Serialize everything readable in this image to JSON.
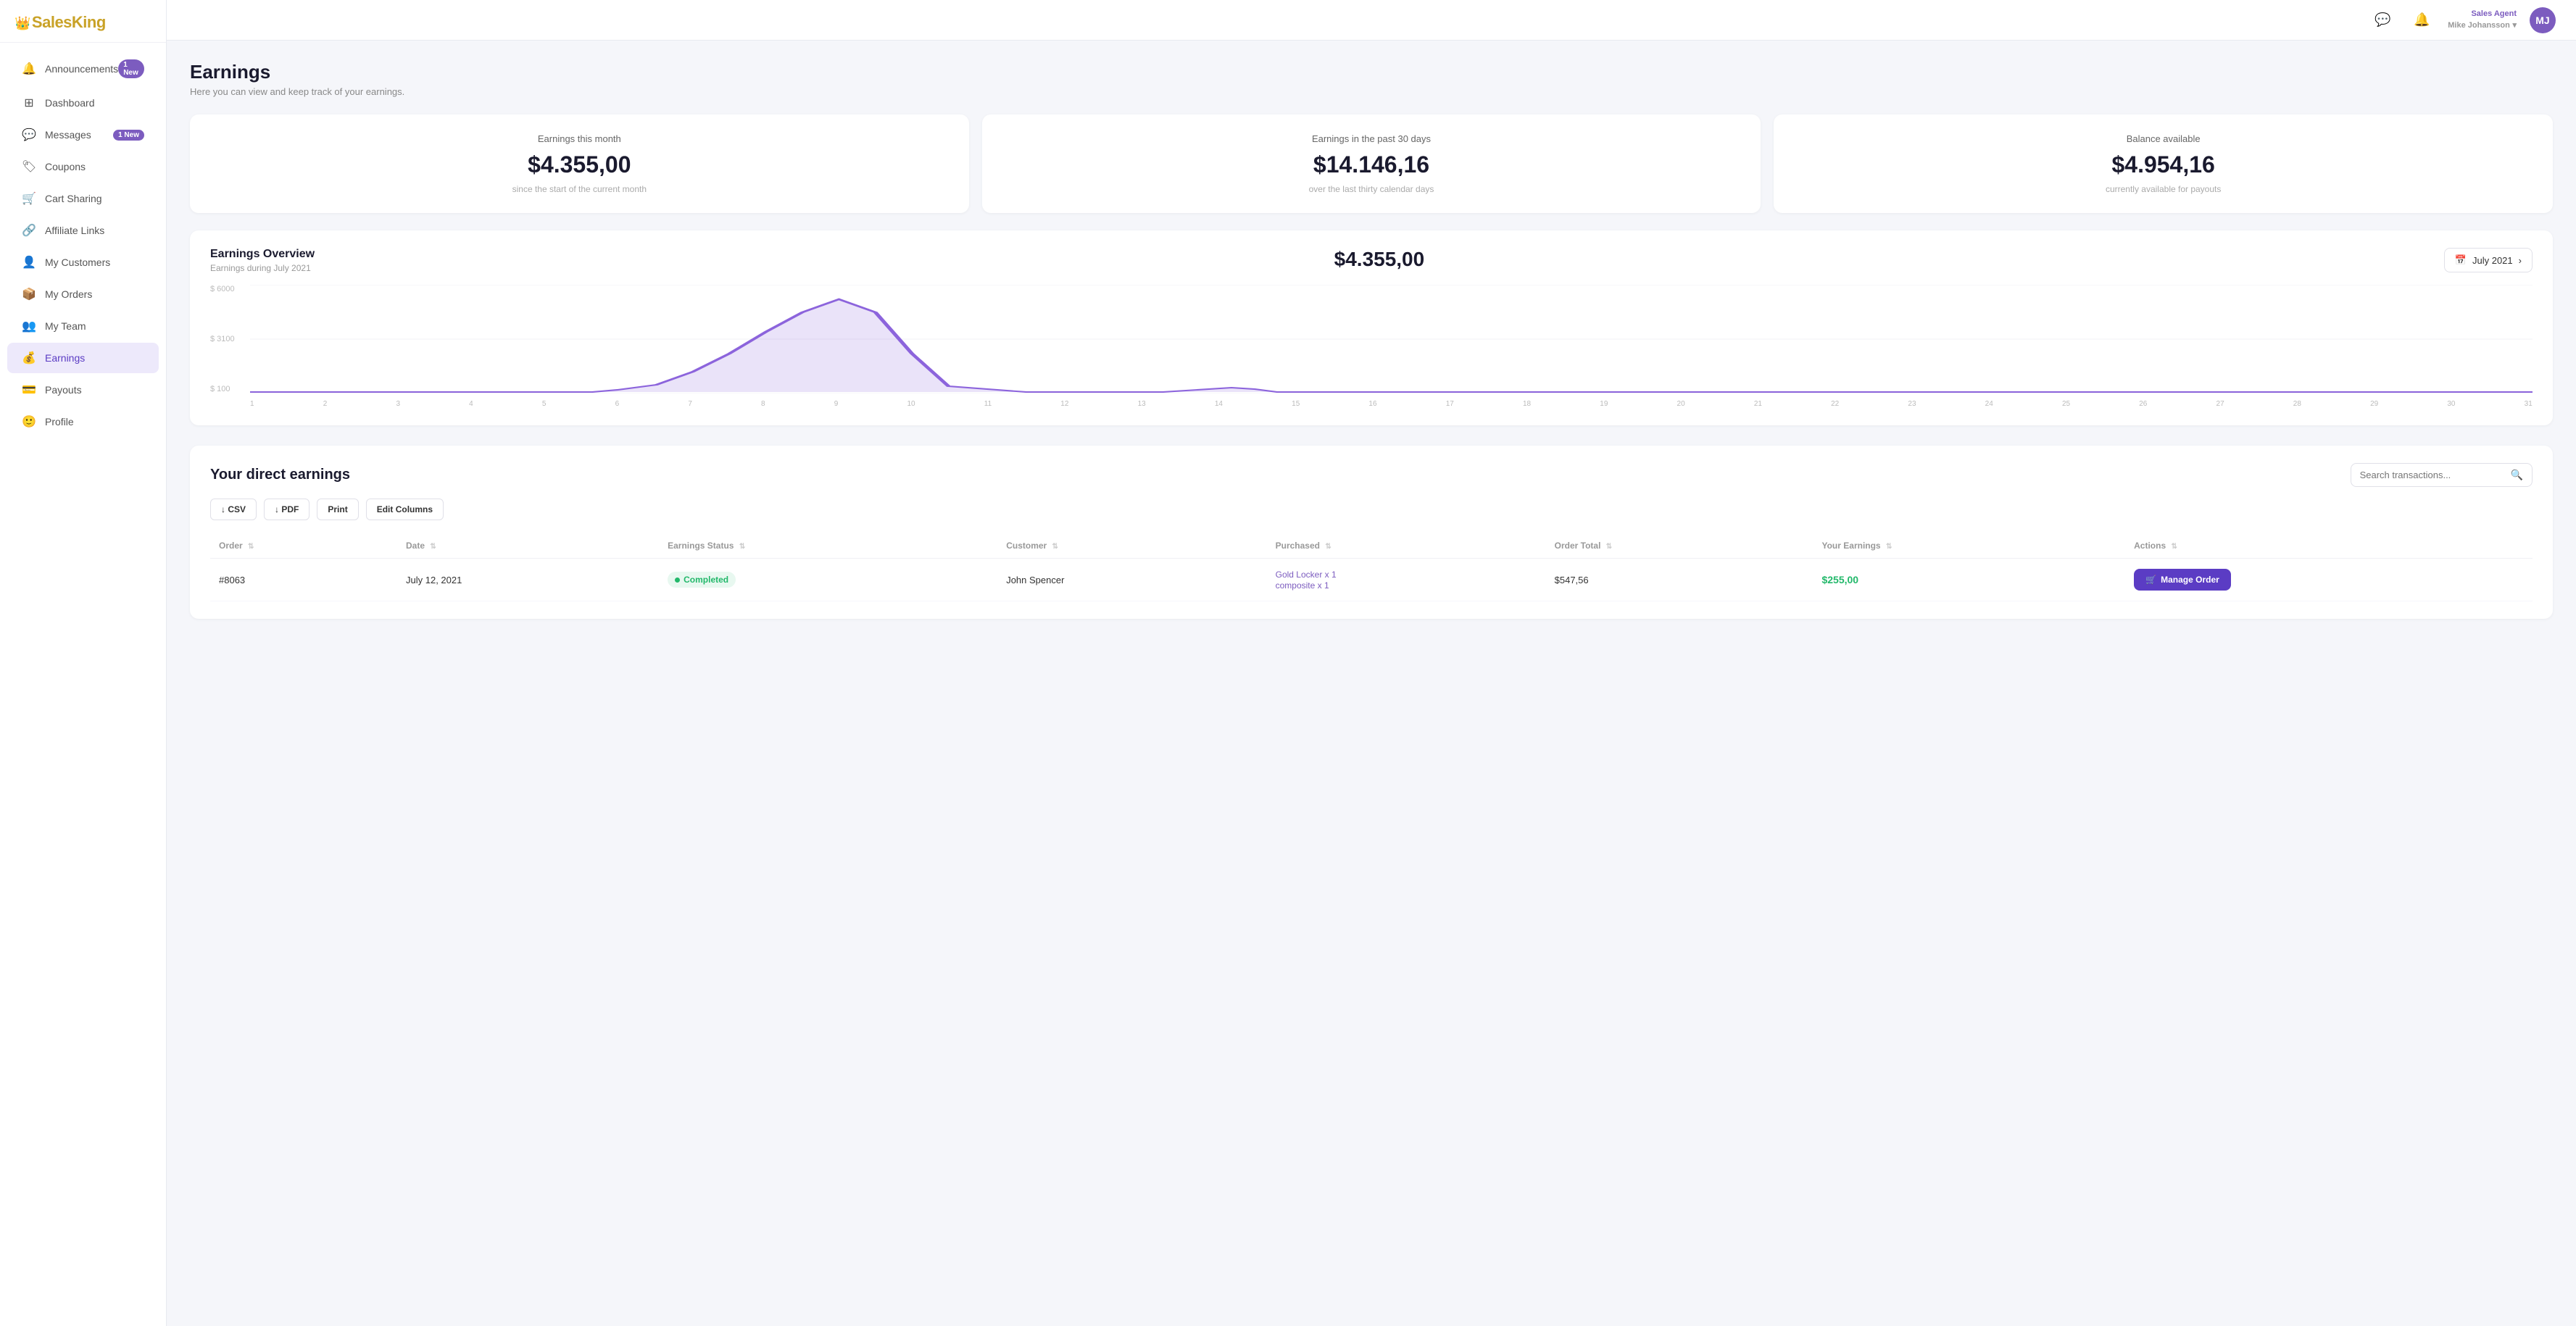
{
  "logo": {
    "crown": "👑",
    "text_dark": "Sales",
    "text_gold": "King"
  },
  "nav": {
    "items": [
      {
        "id": "announcements",
        "label": "Announcements",
        "icon": "🔔",
        "badge": "1 New",
        "active": false
      },
      {
        "id": "dashboard",
        "label": "Dashboard",
        "icon": "⊞",
        "badge": null,
        "active": false
      },
      {
        "id": "messages",
        "label": "Messages",
        "icon": "💬",
        "badge": "1 New",
        "active": false
      },
      {
        "id": "coupons",
        "label": "Coupons",
        "icon": "🏷",
        "badge": null,
        "active": false
      },
      {
        "id": "cart-sharing",
        "label": "Cart Sharing",
        "icon": "🛒",
        "badge": null,
        "active": false
      },
      {
        "id": "affiliate-links",
        "label": "Affiliate Links",
        "icon": "🔗",
        "badge": null,
        "active": false
      },
      {
        "id": "my-customers",
        "label": "My Customers",
        "icon": "👤",
        "badge": null,
        "active": false
      },
      {
        "id": "my-orders",
        "label": "My Orders",
        "icon": "📦",
        "badge": null,
        "active": false
      },
      {
        "id": "my-team",
        "label": "My Team",
        "icon": "👥",
        "badge": null,
        "active": false
      },
      {
        "id": "earnings",
        "label": "Earnings",
        "icon": "💰",
        "badge": null,
        "active": true
      },
      {
        "id": "payouts",
        "label": "Payouts",
        "icon": "💳",
        "badge": null,
        "active": false
      },
      {
        "id": "profile",
        "label": "Profile",
        "icon": "🙂",
        "badge": null,
        "active": false
      }
    ]
  },
  "topbar": {
    "chat_icon": "💬",
    "bell_icon": "🔔",
    "user_role": "Sales Agent",
    "user_name": "Mike Johansson",
    "avatar_initials": "MJ"
  },
  "page": {
    "title": "Earnings",
    "subtitle": "Here you can view and keep track of your earnings."
  },
  "summary_cards": [
    {
      "label": "Earnings this month",
      "amount": "$4.355,00",
      "note": "since the start of the current month"
    },
    {
      "label": "Earnings in the past 30 days",
      "amount": "$14.146,16",
      "note": "over the last thirty calendar days"
    },
    {
      "label": "Balance available",
      "amount": "$4.954,16",
      "note": "currently available for payouts"
    }
  ],
  "chart": {
    "title": "Earnings Overview",
    "subtitle": "Earnings during July 2021",
    "total": "$4.355,00",
    "date_label": "July 2021",
    "y_labels": [
      "$ 6000",
      "$ 3100",
      "$ 100"
    ],
    "x_labels": [
      "1",
      "2",
      "3",
      "4",
      "5",
      "6",
      "7",
      "8",
      "9",
      "10",
      "11",
      "12",
      "13",
      "14",
      "15",
      "16",
      "17",
      "18",
      "19",
      "20",
      "21",
      "22",
      "23",
      "24",
      "25",
      "26",
      "27",
      "28",
      "29",
      "30",
      "31"
    ]
  },
  "direct_earnings": {
    "title": "Your direct earnings",
    "search_placeholder": "Search transactions...",
    "buttons": [
      {
        "id": "csv",
        "label": "↓ CSV"
      },
      {
        "id": "pdf",
        "label": "↓ PDF"
      },
      {
        "id": "print",
        "label": "Print"
      },
      {
        "id": "edit-columns",
        "label": "Edit Columns"
      }
    ],
    "columns": [
      "Order",
      "Date",
      "Earnings Status",
      "Customer",
      "Purchased",
      "Order Total",
      "Your Earnings",
      "Actions"
    ],
    "rows": [
      {
        "order": "#8063",
        "date": "July 12, 2021",
        "status": "Completed",
        "customer": "John Spencer",
        "purchased": [
          "Gold Locker x 1",
          "composite x 1"
        ],
        "order_total": "$547,56",
        "your_earnings": "$255,00",
        "action": "Manage Order"
      }
    ]
  }
}
